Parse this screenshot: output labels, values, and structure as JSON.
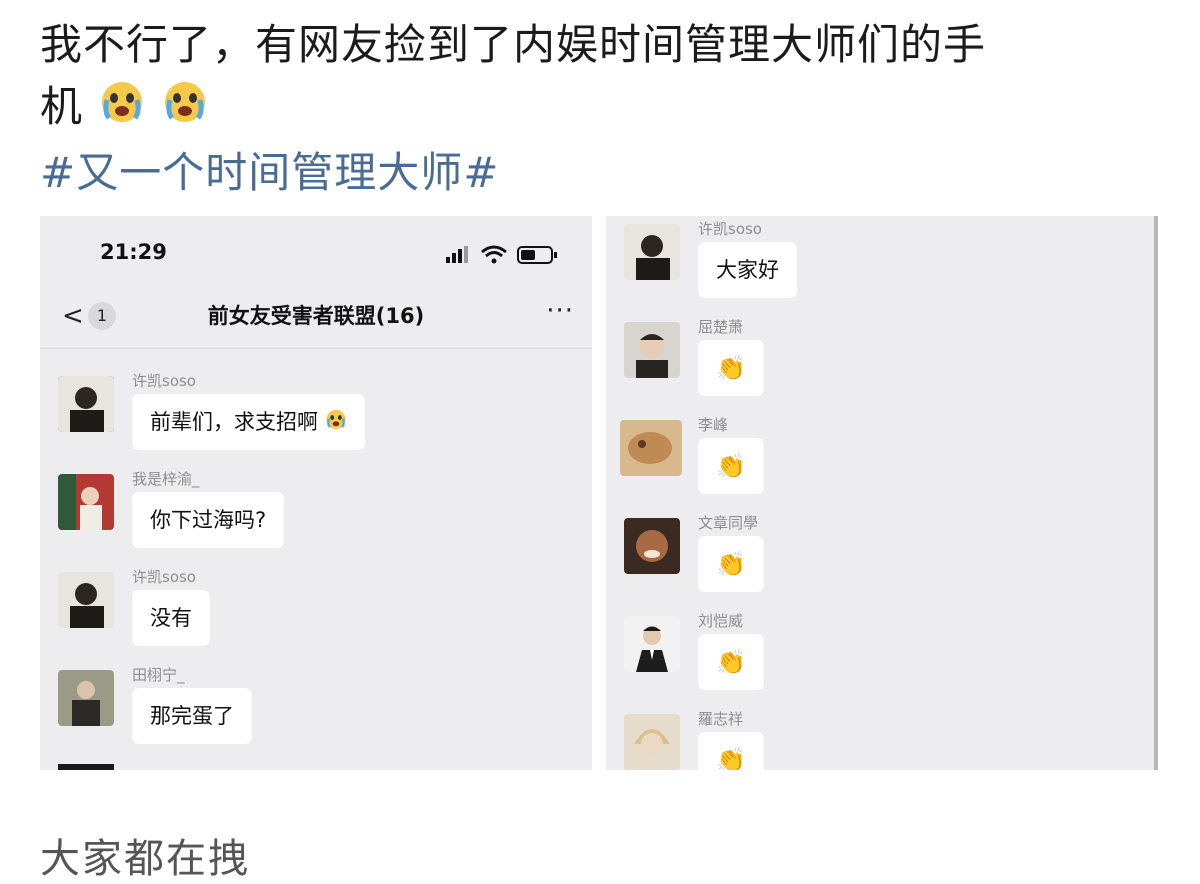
{
  "post": {
    "line1": "我不行了，有网友捡到了内娱时间管理大师们的手",
    "line2": "机",
    "emoji_names": [
      "crying-face-icon",
      "crying-face-icon"
    ],
    "hashtag": "#又一个时间管理大师#",
    "continuation": "大家都在拽"
  },
  "left_screen": {
    "status": {
      "time": "21:29"
    },
    "nav": {
      "back_symbol": "<",
      "back_count": "1",
      "title": "前女友受害者联盟(16)",
      "more": "···"
    },
    "messages": [
      {
        "sender": "许凯soso",
        "text": "前辈们，求支招啊",
        "emoji": "crying-face-icon",
        "avatar_color": "#3a3530"
      },
      {
        "sender": "我是梓渝_",
        "text": "你下过海吗?",
        "avatar_color": "#b23a32"
      },
      {
        "sender": "许凯soso",
        "text": "没有",
        "avatar_color": "#3a3530"
      },
      {
        "sender": "田栩宁_",
        "text": "那完蛋了",
        "avatar_color": "#5a5a4e"
      }
    ]
  },
  "right_screen": {
    "messages": [
      {
        "sender": "许凯soso",
        "text": "大家好",
        "avatar_color": "#3a3530"
      },
      {
        "sender": "屈楚萧",
        "text": "👏",
        "avatar_color": "#6b6058"
      },
      {
        "sender": "李峰",
        "text": "👏",
        "avatar_color": "#c9a070"
      },
      {
        "sender": "文章同學",
        "text": "👏",
        "avatar_color": "#7a4a30"
      },
      {
        "sender": "刘恺威",
        "text": "👏",
        "avatar_color": "#dcdcdc"
      },
      {
        "sender": "羅志祥",
        "text": "👏",
        "avatar_color": "#c7b48a"
      }
    ]
  },
  "colors": {
    "hashtag": "#4a6b93",
    "bubble": "#ffffff",
    "chat_bg": "#ededef"
  }
}
